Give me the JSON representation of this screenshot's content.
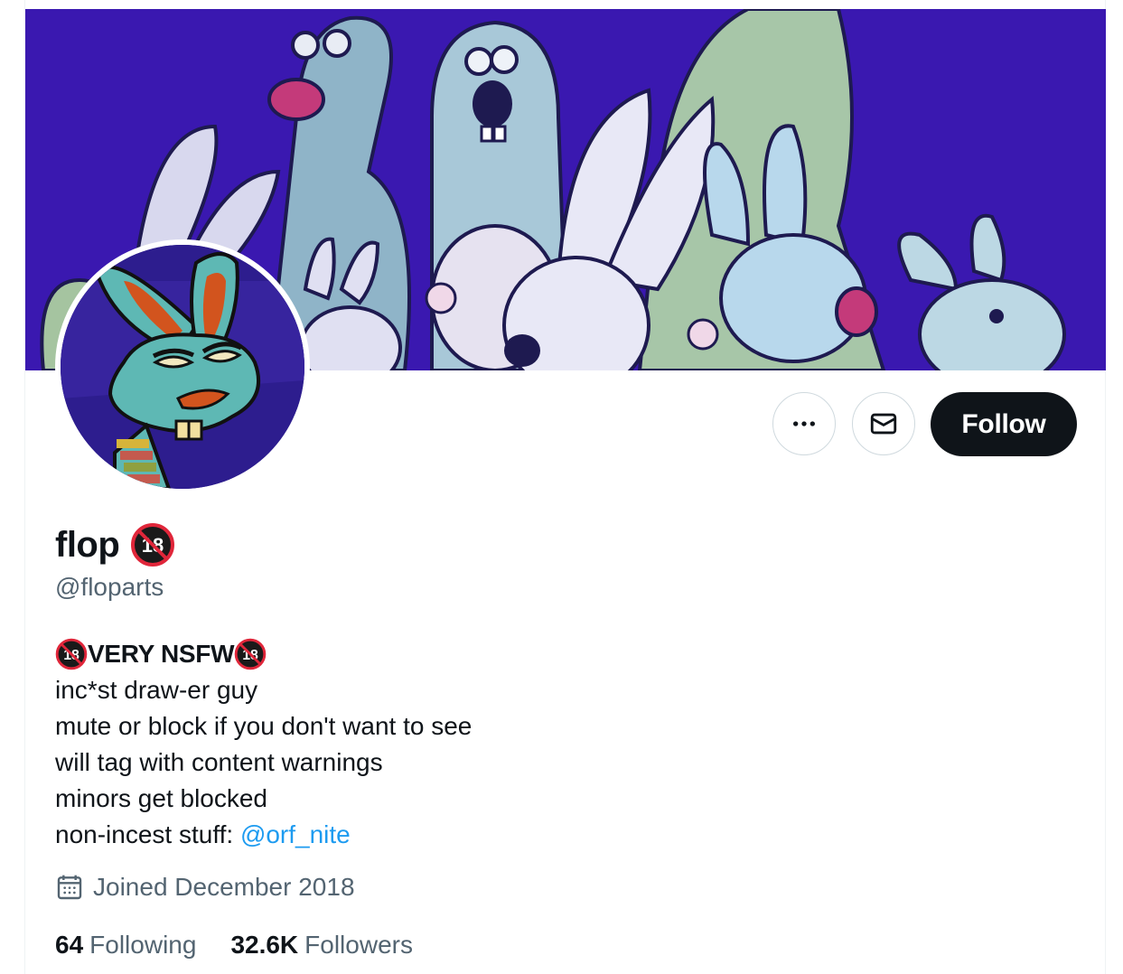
{
  "profile": {
    "display_name": "flop",
    "handle": "@floparts",
    "name_badge_icon": "no-one-under-18-icon"
  },
  "actions": {
    "more_icon": "more-icon",
    "message_icon": "envelope-icon",
    "follow_label": "Follow"
  },
  "bio": {
    "heading": "VERY NSFW",
    "lines": [
      "inc*st draw-er guy",
      "mute or block if you don't want to see",
      "will tag with content warnings",
      "minors get blocked"
    ],
    "last_line_prefix": "non-incest stuff: ",
    "mention": "@orf_nite"
  },
  "joined": {
    "icon": "calendar-icon",
    "text": "Joined December 2018"
  },
  "stats": {
    "following_count": "64",
    "following_label": "Following",
    "followers_count": "32.6K",
    "followers_label": "Followers"
  },
  "colors": {
    "banner_bg": "#3a18b0",
    "follow_button": "#0f1419",
    "link": "#1d9bf0",
    "secondary_text": "#536471"
  }
}
